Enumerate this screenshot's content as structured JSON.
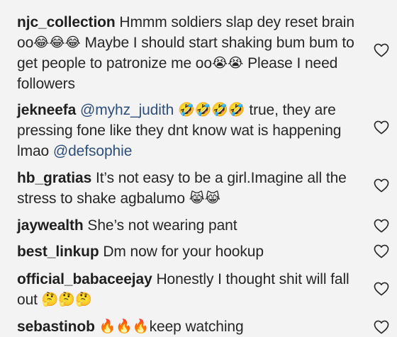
{
  "comments": [
    {
      "username": "njc_collection",
      "text_1": "Hmmm soldiers slap dey reset brain oo",
      "emoji_1": "😂😂😂",
      "text_2": "Maybe I should start shaking bum bum to get people to patronize me oo",
      "emoji_2": "😭😭",
      "text_3": "Please I need followers",
      "like_icon": "heart-outline-icon"
    },
    {
      "username": "jekneefa",
      "mention_1": "@myhz_judith",
      "emoji_1": "🤣🤣🤣🤣",
      "text_1": "true, they are pressing fone like they dnt know wat is happening lmao",
      "mention_2": "@defsophie",
      "like_icon": "heart-outline-icon"
    },
    {
      "username": "hb_gratias",
      "text_1": "It’s not easy to be a girl.Imagine all the stress to shake agbalumo",
      "emoji_1": "😹😹",
      "like_icon": "heart-outline-icon"
    },
    {
      "username": "jaywealth",
      "text_1": "She’s not wearing pant",
      "like_icon": "heart-outline-icon"
    },
    {
      "username": "best_linkup",
      "text_1": "Dm now for your hookup",
      "like_icon": "heart-outline-icon"
    },
    {
      "username": "official_babaceejay",
      "text_1": "Honestly I thought shit will fall out",
      "emoji_1": "🤔🤔🤔",
      "like_icon": "heart-outline-icon"
    },
    {
      "username": "sebastinob",
      "emoji_1": "🔥🔥🔥",
      "text_1": "keep watching",
      "like_icon": "heart-outline-icon"
    }
  ],
  "colors": {
    "background": "#f3f3f3",
    "text": "#262626",
    "mention": "#2e4f7a",
    "heart_stroke": "#262626"
  }
}
